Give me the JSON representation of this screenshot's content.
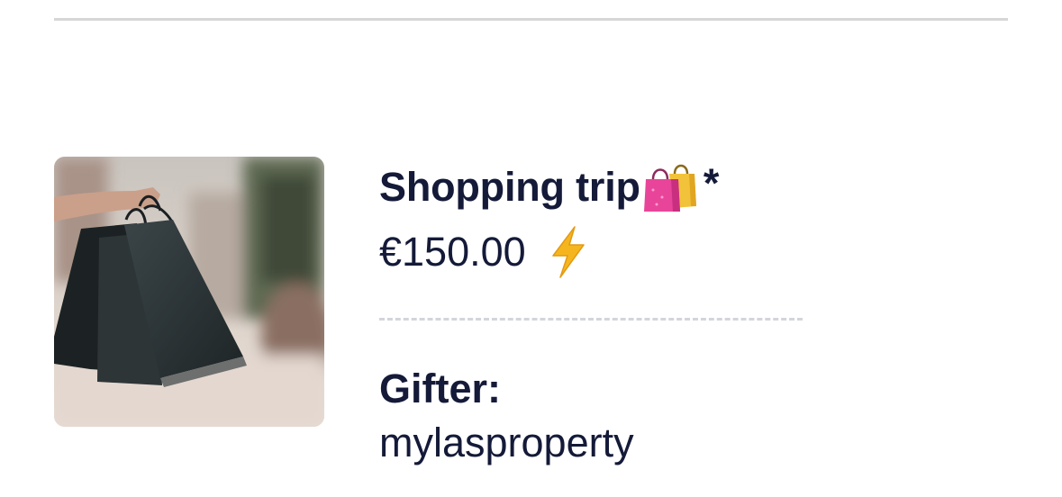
{
  "item": {
    "title": "Shopping trip",
    "title_icon": "shopping-bags-icon",
    "required_marker": "*",
    "price": "€150.00",
    "price_icon": "lightning-bolt-icon",
    "image_description_icon": "shopping-bags-photo",
    "gifter_label": "Gifter:",
    "gifter_name": "mylasproperty"
  },
  "colors": {
    "text": "#141a38",
    "divider": "#d6d6d6",
    "dashed_divider": "#d3d5db",
    "bolt": "#f5b51f",
    "bag_pink": "#e8459a",
    "bag_yellow": "#f2c23a"
  }
}
